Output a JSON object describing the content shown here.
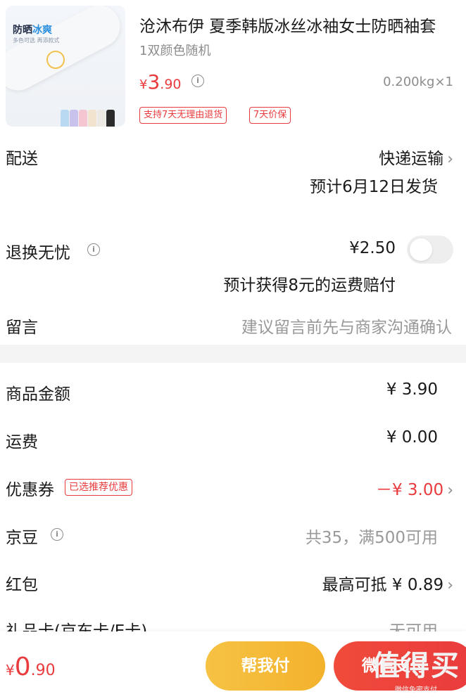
{
  "product": {
    "title": "沧沐布伊 夏季韩版冰丝冰袖女士防晒袖套",
    "variant": "1双颜色随机",
    "price_currency": "¥",
    "price_int": "3",
    "price_dec": ".90",
    "weight": "0.200kg×1",
    "tags": [
      "支持7天无理由退货",
      "7天价保"
    ],
    "thumb_text_a": "防晒",
    "thumb_text_b": "冰爽",
    "thumb_sub": "多色可选 再添款式"
  },
  "delivery": {
    "label": "配送",
    "method": "快递运输",
    "estimate": "预计6月12日发货"
  },
  "return_insurance": {
    "label": "退换无忧",
    "price": "¥2.50",
    "note": "预计获得8元的运费赔付",
    "enabled": false
  },
  "message": {
    "label": "留言",
    "placeholder": "建议留言前先与商家沟通确认"
  },
  "summary": {
    "goods_label": "商品金额",
    "goods_value": "¥ 3.90",
    "shipping_label": "运费",
    "shipping_value": "¥ 0.00",
    "coupon_label": "优惠券",
    "coupon_tag": "已选推荐优惠",
    "coupon_value": "－¥ 3.00",
    "beans_label": "京豆",
    "beans_value": "共35，满500可用",
    "redpacket_label": "红包",
    "redpacket_value": "最高可抵 ¥ 0.89",
    "giftcard_label": "礼品卡(京东卡/E卡)",
    "giftcard_value": "无可用"
  },
  "bottom": {
    "total_currency": "¥",
    "total_int": "0",
    "total_dec": ".90",
    "help_pay": "帮我付",
    "pay": "微信支付"
  },
  "watermark": {
    "big": "值得买",
    "small": "微信免密支付"
  },
  "colors": {
    "accent": "#e93b3d",
    "help_button": "#f3b22c",
    "muted": "#8c8c8c"
  }
}
